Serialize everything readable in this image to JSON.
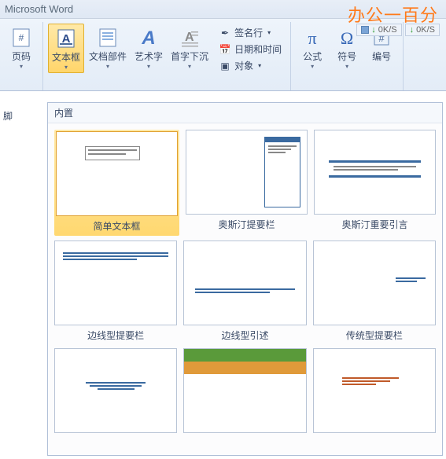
{
  "title": "Microsoft Word",
  "watermark": "办公一百分",
  "netstats": {
    "speed1": "0K/S",
    "speed2": "0K/S"
  },
  "ribbon": {
    "page_number": "页码",
    "textbox": "文本框",
    "doc_parts": "文档部件",
    "wordart": "艺术字",
    "dropcap": "首字下沉",
    "sig_line": "签名行",
    "date_time": "日期和时间",
    "object": "对象",
    "equation": "公式",
    "symbol": "符号",
    "number": "编号"
  },
  "side_label": "脚",
  "gallery": {
    "header": "内置",
    "items": [
      "简单文本框",
      "奥斯汀提要栏",
      "奥斯汀重要引言",
      "边线型提要栏",
      "边线型引述",
      "传统型提要栏"
    ]
  }
}
